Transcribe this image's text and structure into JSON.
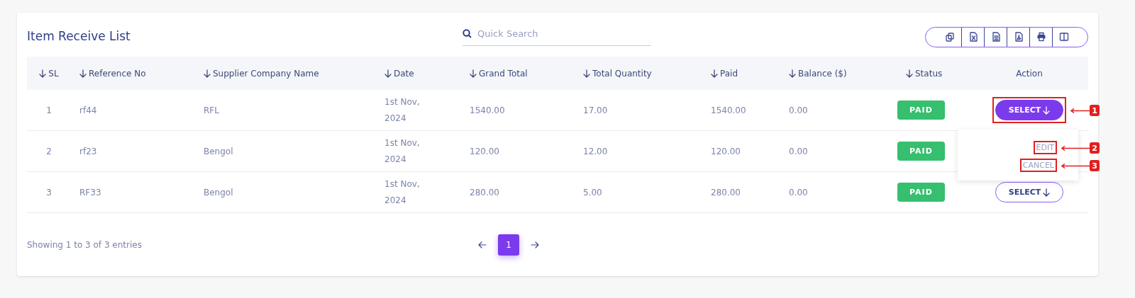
{
  "title": "Item Receive List",
  "search": {
    "placeholder": "Quick Search"
  },
  "toolbar": [
    {
      "kind": "copy"
    },
    {
      "kind": "excel"
    },
    {
      "kind": "document"
    },
    {
      "kind": "pdf"
    },
    {
      "kind": "print"
    },
    {
      "kind": "columns"
    }
  ],
  "table": {
    "columns": [
      {
        "label": "SL",
        "sortable": true
      },
      {
        "label": "Reference No",
        "sortable": true
      },
      {
        "label": "Supplier Company Name",
        "sortable": true
      },
      {
        "label": "Date",
        "sortable": true
      },
      {
        "label": "Grand Total",
        "sortable": true
      },
      {
        "label": "Total Quantity",
        "sortable": true
      },
      {
        "label": "Paid",
        "sortable": true
      },
      {
        "label": "Balance ($)",
        "sortable": true
      },
      {
        "label": "Status",
        "sortable": true
      },
      {
        "label": "Action",
        "sortable": false
      }
    ],
    "rows": [
      {
        "sl": "1",
        "reference": "rf44",
        "supplier": "RFL",
        "date": "1st Nov, 2024",
        "grand_total": "1540.00",
        "total_quantity": "17.00",
        "paid": "1540.00",
        "balance": "0.00",
        "status": "PAID",
        "action": {
          "label": "SELECT",
          "open": true,
          "annotation": "1",
          "menu": [
            {
              "label": "EDIT",
              "annotation": "2"
            },
            {
              "label": "CANCEL",
              "annotation": "3"
            }
          ]
        }
      },
      {
        "sl": "2",
        "reference": "rf23",
        "supplier": "Bengol",
        "date": "1st Nov, 2024",
        "grand_total": "120.00",
        "total_quantity": "12.00",
        "paid": "120.00",
        "balance": "0.00",
        "status": "PAID"
      },
      {
        "sl": "3",
        "reference": "RF33",
        "supplier": "Bengol",
        "date": "1st Nov, 2024",
        "grand_total": "280.00",
        "total_quantity": "5.00",
        "paid": "280.00",
        "balance": "0.00",
        "status": "PAID",
        "action": {
          "label": "SELECT",
          "open": false
        }
      }
    ]
  },
  "footer": {
    "info": "Showing 1 to 3 of 3 entries",
    "pages": [
      {
        "label": "1",
        "selected": true
      }
    ]
  }
}
